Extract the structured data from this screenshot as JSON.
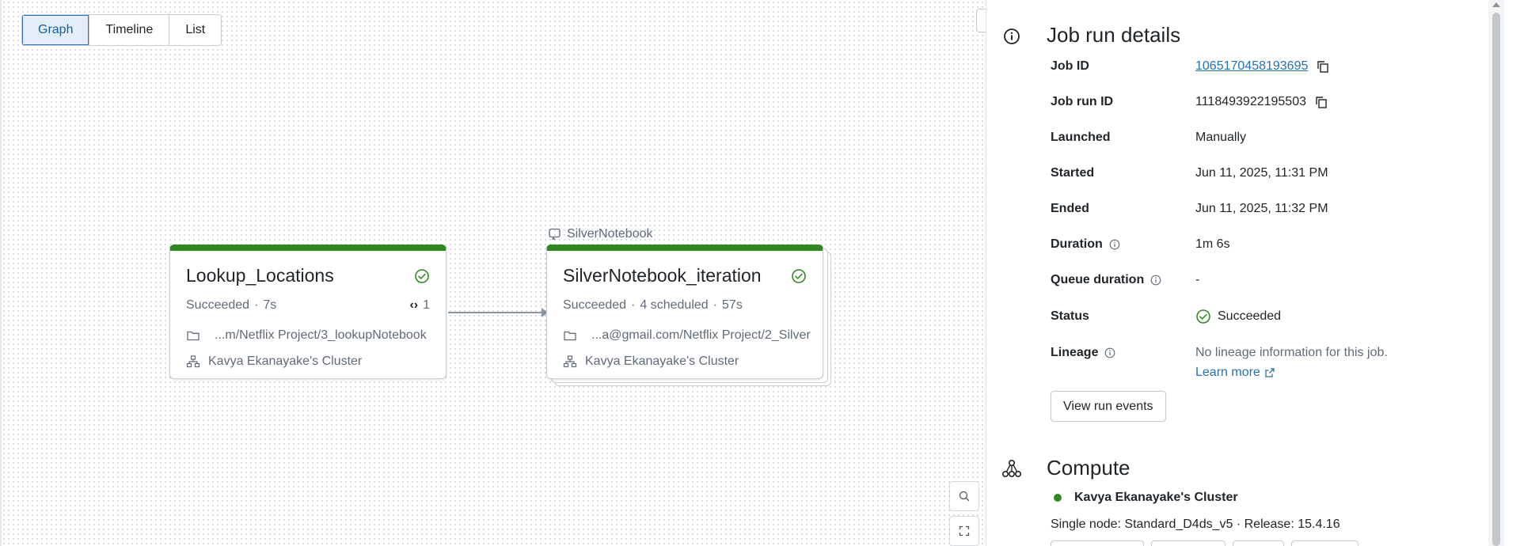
{
  "view_tabs": [
    {
      "label": "Graph",
      "active": true
    },
    {
      "label": "Timeline",
      "active": false
    },
    {
      "label": "List",
      "active": false
    }
  ],
  "graph": {
    "nodes": [
      {
        "title": "Lookup_Locations",
        "status": "Succeeded",
        "duration": "7s",
        "iterations": "1",
        "path": "...m/Netflix Project/3_lookupNotebook",
        "cluster": "Kavya Ekanayake's Cluster"
      },
      {
        "group_label": "SilverNotebook",
        "title": "SilverNotebook_iteration",
        "status": "Succeeded",
        "scheduled": "4 scheduled",
        "duration": "57s",
        "path": "...a@gmail.com/Netflix Project/2_Silver",
        "cluster": "Kavya Ekanayake's Cluster"
      }
    ],
    "status_color": "#2e8a1e"
  },
  "details": {
    "title": "Job run details",
    "rows": {
      "job_id": {
        "label": "Job ID",
        "value": "1065170458193695"
      },
      "job_run_id": {
        "label": "Job run ID",
        "value": "1118493922195503"
      },
      "launched": {
        "label": "Launched",
        "value": "Manually"
      },
      "started": {
        "label": "Started",
        "value": "Jun 11, 2025, 11:31 PM"
      },
      "ended": {
        "label": "Ended",
        "value": "Jun 11, 2025, 11:32 PM"
      },
      "duration": {
        "label": "Duration",
        "value": "1m 6s"
      },
      "queue_duration": {
        "label": "Queue duration",
        "value": "-"
      },
      "status": {
        "label": "Status",
        "value": "Succeeded"
      },
      "lineage": {
        "label": "Lineage",
        "value": "No lineage information for this job.",
        "link": "Learn more"
      }
    },
    "view_events_button": "View run events"
  },
  "compute": {
    "title": "Compute",
    "cluster_name": "Kavya Ekanayake's Cluster",
    "cluster_status_color": "#2e8a1e",
    "spec": "Single node: Standard_D4ds_v5 · Release: 15.4.16"
  },
  "colors": {
    "accent": "#2272b4",
    "success": "#2e8a1e"
  }
}
